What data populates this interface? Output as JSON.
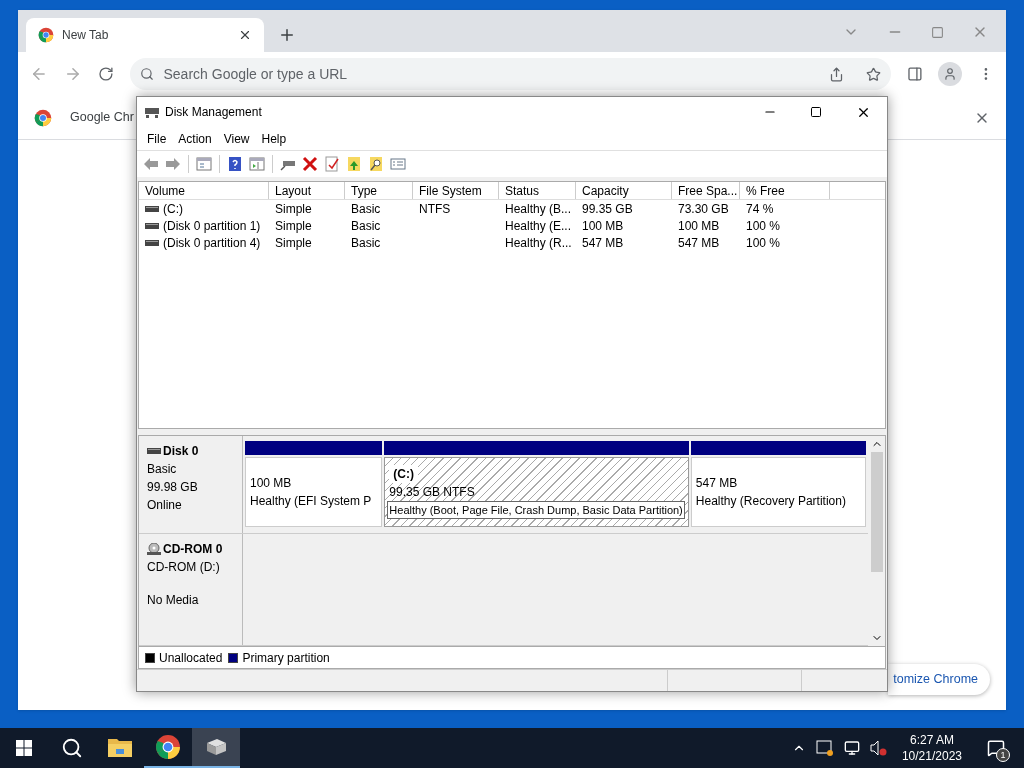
{
  "browser": {
    "tab_title": "New Tab",
    "omnibox_placeholder": "Search Google or type a URL",
    "infobar_text": "Google Chr",
    "customize_label": "tomize Chrome"
  },
  "disk_window": {
    "title": "Disk Management",
    "menu": [
      "File",
      "Action",
      "View",
      "Help"
    ],
    "columns": [
      "Volume",
      "Layout",
      "Type",
      "File System",
      "Status",
      "Capacity",
      "Free Spa...",
      "% Free"
    ],
    "rows": [
      {
        "cells": [
          "(C:)",
          "Simple",
          "Basic",
          "NTFS",
          "Healthy (B...",
          "99.35 GB",
          "73.30 GB",
          "74 %"
        ]
      },
      {
        "cells": [
          "(Disk 0 partition 1)",
          "Simple",
          "Basic",
          "",
          "Healthy (E...",
          "100 MB",
          "100 MB",
          "100 %"
        ]
      },
      {
        "cells": [
          "(Disk 0 partition 4)",
          "Simple",
          "Basic",
          "",
          "Healthy (R...",
          "547 MB",
          "547 MB",
          "100 %"
        ]
      }
    ],
    "disks": [
      {
        "kind": "disk",
        "name": "Disk 0",
        "info": [
          "Basic",
          "99.98 GB",
          "Online"
        ],
        "partitions": [
          {
            "size": "100 MB",
            "status": "Healthy (EFI System P",
            "selected": false
          },
          {
            "label": "(C:)",
            "size": "99.35 GB NTFS",
            "status": "Healthy (Boot, Page File, Crash Dump, Basic Data Partition)",
            "selected": true
          },
          {
            "size": "547 MB",
            "status": "Healthy (Recovery Partition)",
            "selected": false
          }
        ]
      },
      {
        "kind": "cdrom",
        "name": "CD-ROM 0",
        "info": [
          "CD-ROM (D:)"
        ],
        "status": "No Media"
      }
    ],
    "legend": [
      {
        "label": "Unallocated",
        "color": "#000000"
      },
      {
        "label": "Primary partition",
        "color": "#000080"
      }
    ]
  },
  "taskbar": {
    "apps": [
      {
        "kind": "folder",
        "running": false,
        "selected": false
      },
      {
        "kind": "browser",
        "running": true,
        "selected": false
      },
      {
        "kind": "disk",
        "running": true,
        "selected": true
      }
    ],
    "time": "6:27 AM",
    "date": "10/21/2023",
    "notification_count": "1"
  }
}
